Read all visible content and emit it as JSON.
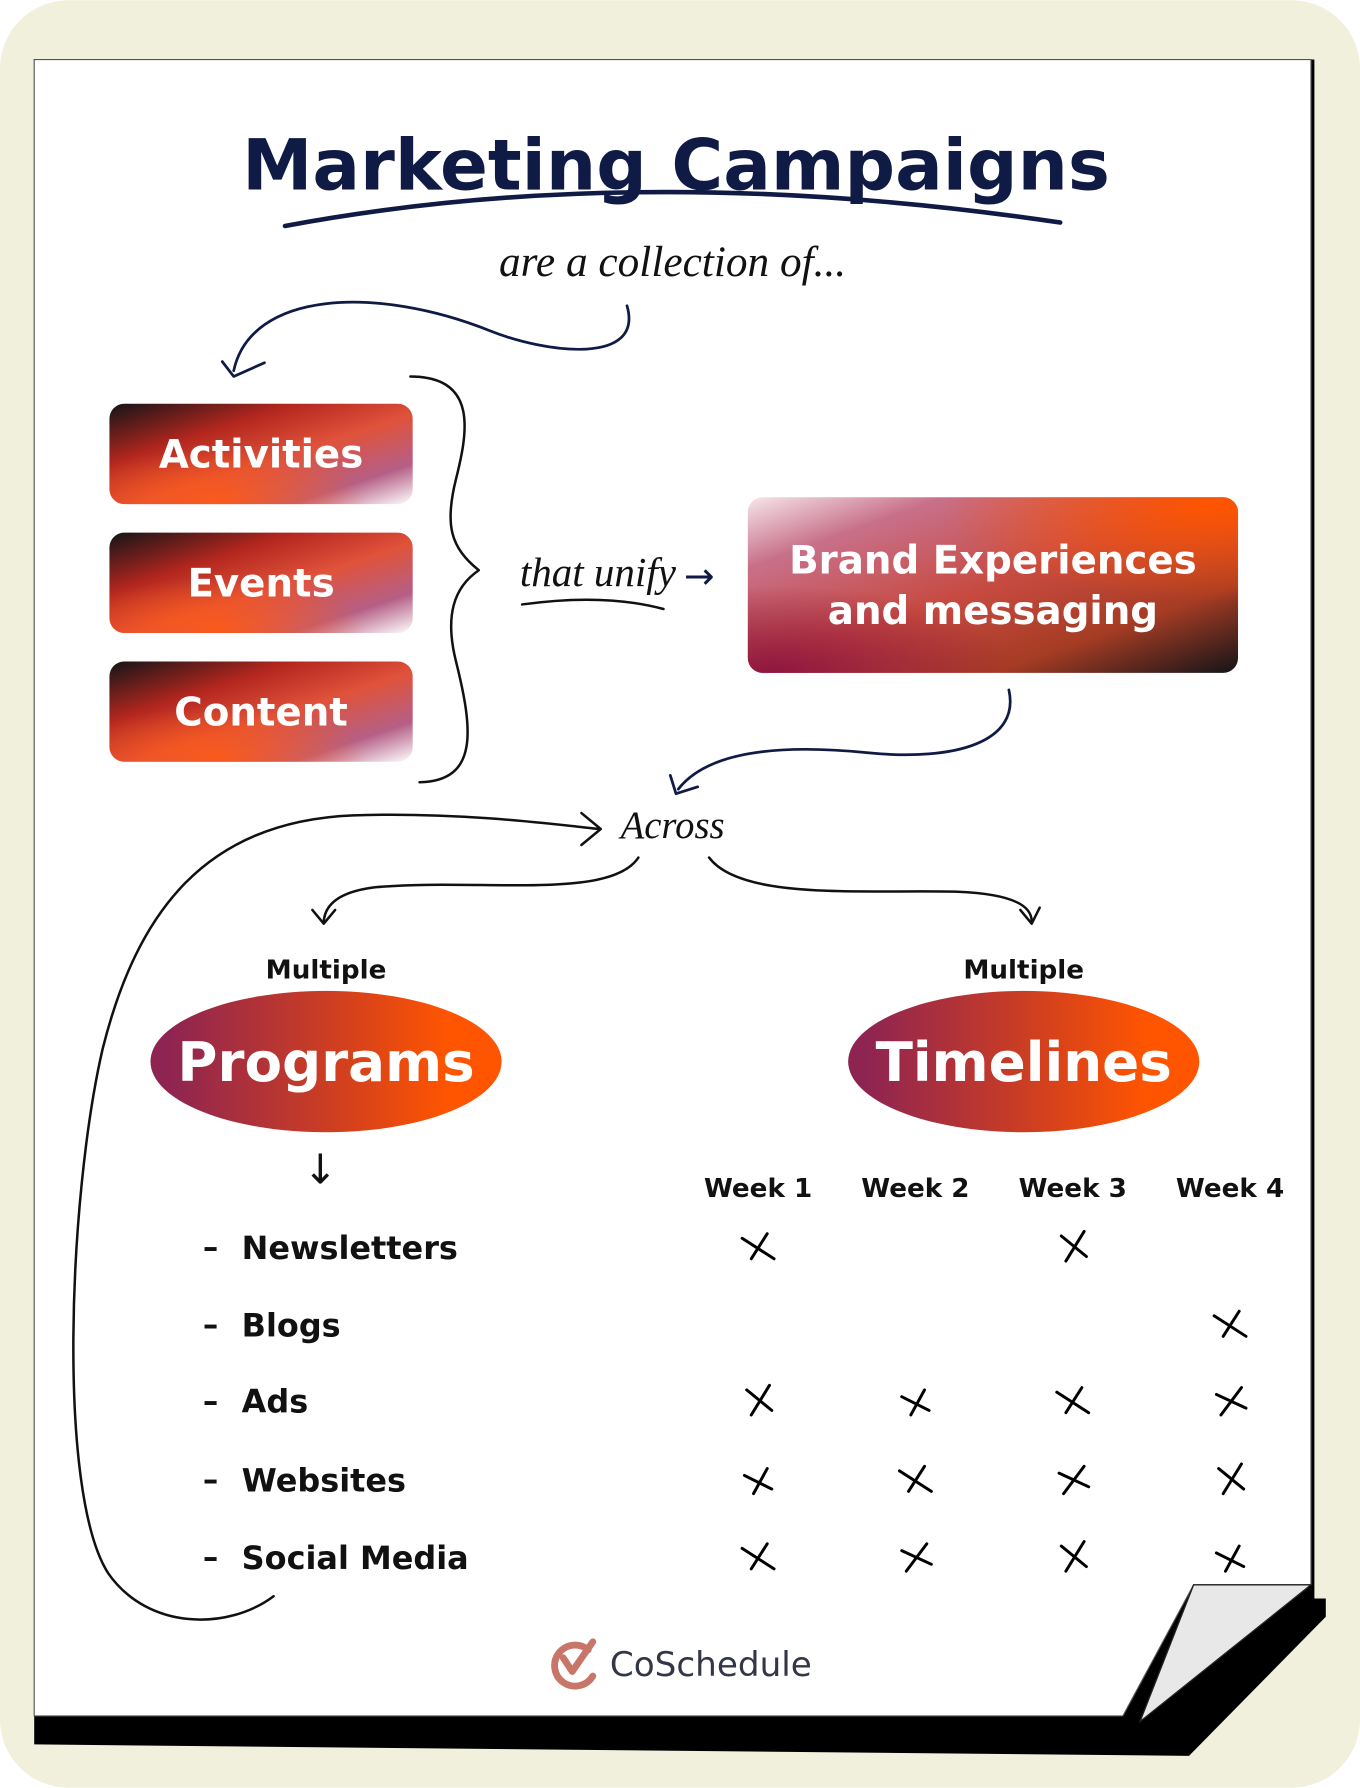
{
  "title": "Marketing Campaigns",
  "subtitle": "are a collection of...",
  "items": [
    {
      "label": "Activities"
    },
    {
      "label": "Events"
    },
    {
      "label": "Content"
    }
  ],
  "connector_text": "that unify",
  "connector_arrow": "→",
  "brand_box": {
    "line1": "Brand Experiences",
    "line2": "and messaging"
  },
  "across_text": "Across",
  "programs": {
    "qualifier": "Multiple",
    "label": "Programs",
    "arrow": "↓"
  },
  "timelines": {
    "qualifier": "Multiple",
    "label": "Timelines"
  },
  "schedule": {
    "weeks": [
      "Week 1",
      "Week 2",
      "Week 3",
      "Week 4"
    ],
    "rows": [
      {
        "program": "Newsletters",
        "weeks": [
          true,
          false,
          true,
          false
        ]
      },
      {
        "program": "Blogs",
        "weeks": [
          false,
          false,
          false,
          true
        ]
      },
      {
        "program": "Ads",
        "weeks": [
          true,
          true,
          true,
          true
        ]
      },
      {
        "program": "Websites",
        "weeks": [
          true,
          true,
          true,
          true
        ]
      },
      {
        "program": "Social Media",
        "weeks": [
          true,
          true,
          true,
          true
        ]
      }
    ],
    "dash": "–"
  },
  "logo": {
    "name": "CoSchedule",
    "icon": "check-circle-icon",
    "color": "#c8766a"
  },
  "colors": {
    "background": "#f1f0dc",
    "navy": "#0f1a45",
    "orange": "#ff5500",
    "magenta": "#8e1f4c"
  }
}
